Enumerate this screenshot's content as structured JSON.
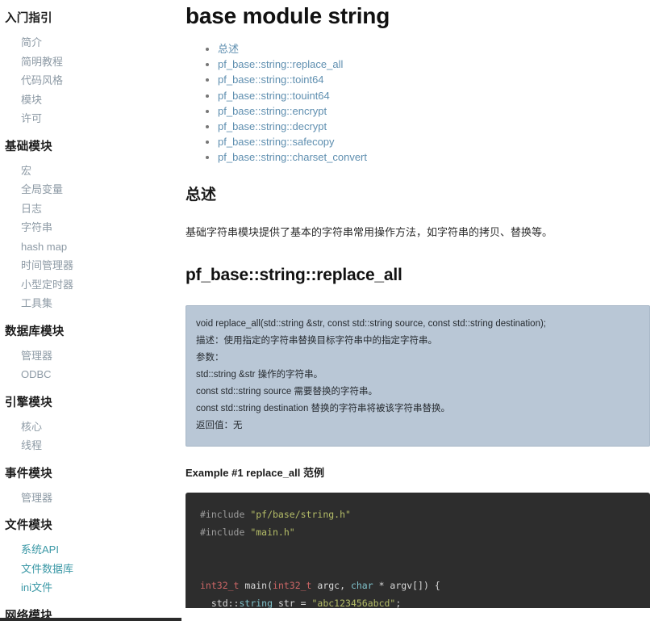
{
  "sidebar": {
    "sections": [
      {
        "title": "入门指引",
        "items": [
          {
            "label": "简介",
            "style": "muted"
          },
          {
            "label": "简明教程",
            "style": "muted"
          },
          {
            "label": "代码风格",
            "style": "muted"
          },
          {
            "label": "模块",
            "style": "muted"
          },
          {
            "label": "许可",
            "style": "muted"
          }
        ]
      },
      {
        "title": "基础模块",
        "items": [
          {
            "label": "宏",
            "style": "muted"
          },
          {
            "label": "全局变量",
            "style": "muted"
          },
          {
            "label": "日志",
            "style": "muted"
          },
          {
            "label": "字符串",
            "style": "muted"
          },
          {
            "label": "hash map",
            "style": "muted"
          },
          {
            "label": "时间管理器",
            "style": "muted"
          },
          {
            "label": "小型定时器",
            "style": "muted"
          },
          {
            "label": "工具集",
            "style": "muted"
          }
        ]
      },
      {
        "title": "数据库模块",
        "items": [
          {
            "label": "管理器",
            "style": "muted"
          },
          {
            "label": "ODBC",
            "style": "muted"
          }
        ]
      },
      {
        "title": "引擎模块",
        "items": [
          {
            "label": "核心",
            "style": "muted"
          },
          {
            "label": "线程",
            "style": "muted"
          }
        ]
      },
      {
        "title": "事件模块",
        "items": [
          {
            "label": "管理器",
            "style": "muted"
          }
        ]
      },
      {
        "title": "文件模块",
        "items": [
          {
            "label": "系统API",
            "style": "teal"
          },
          {
            "label": "文件数据库",
            "style": "teal"
          },
          {
            "label": "ini文件",
            "style": "teal"
          }
        ]
      },
      {
        "title": "网络模块",
        "items": []
      }
    ]
  },
  "main": {
    "title": "base module string",
    "toc": [
      "总述",
      "pf_base::string::replace_all",
      "pf_base::string::toint64",
      "pf_base::string::touint64",
      "pf_base::string::encrypt",
      "pf_base::string::decrypt",
      "pf_base::string::safecopy",
      "pf_base::string::charset_convert"
    ],
    "overview_heading": "总述",
    "overview_text": "基础字符串模块提供了基本的字符串常用操作方法，如字符串的拷贝、替换等。",
    "function_heading": "pf_base::string::replace_all",
    "signature_lines": [
      "void replace_all(std::string &str, const std::string source, const std::string destination);",
      "描述：使用指定的字符串替换目标字符串中的指定字符串。",
      "参数：",
      "std::string &str 操作的字符串。",
      "const std::string source 需要替换的字符串。",
      "const std::string destination 替换的字符串将被该字符串替换。",
      "返回值：无"
    ],
    "example_heading": "Example #1 replace_all 范例",
    "code_lines": [
      [
        {
          "t": "#include ",
          "c": "pre"
        },
        {
          "t": "\"pf/base/string.h\"",
          "c": "str"
        }
      ],
      [
        {
          "t": "#include ",
          "c": "pre"
        },
        {
          "t": "\"main.h\"",
          "c": "str"
        }
      ],
      [],
      [],
      [
        {
          "t": "int32_t",
          "c": "type"
        },
        {
          "t": " main(",
          "c": "plain"
        },
        {
          "t": "int32_t",
          "c": "type"
        },
        {
          "t": " argc, ",
          "c": "plain"
        },
        {
          "t": "char",
          "c": "kw"
        },
        {
          "t": " * argv[]) {",
          "c": "plain"
        }
      ],
      [
        {
          "t": "  std::",
          "c": "plain"
        },
        {
          "t": "string",
          "c": "kw"
        },
        {
          "t": " str = ",
          "c": "plain"
        },
        {
          "t": "\"abc123456abcd\"",
          "c": "str"
        },
        {
          "t": ";",
          "c": "plain"
        }
      ]
    ]
  },
  "colors": {
    "link_muted": "#8d9aa5",
    "link_teal": "#3b98a6",
    "toc_link": "#5f8fb0",
    "sig_box_bg": "#b9c7d6",
    "code_bg": "#2d2d2d"
  }
}
